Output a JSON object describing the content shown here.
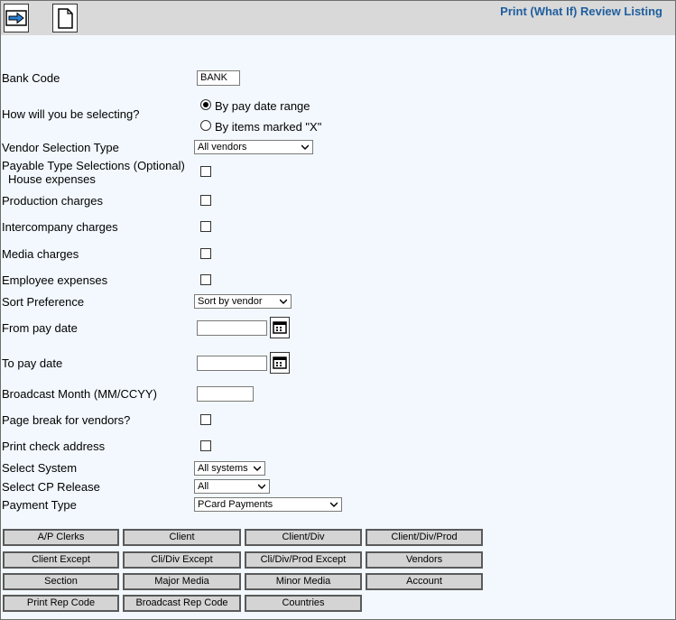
{
  "header": {
    "title": "Print (What If) Review Listing",
    "icons": [
      "arrow-right-icon",
      "document-icon"
    ]
  },
  "form": {
    "bank_code_label": "Bank Code",
    "bank_code_value": "BANK",
    "selecting_label": "How will you be selecting?",
    "radio_pay_date": "By pay date range",
    "radio_items_x": "By items marked \"X\"",
    "vendor_selection_label": "Vendor Selection Type",
    "vendor_selection_value": "All vendors",
    "payable_type_label": "Payable Type Selections (Optional)",
    "house_expenses_label": "House expenses",
    "production_charges_label": "Production charges",
    "intercompany_charges_label": "Intercompany charges",
    "media_charges_label": "Media charges",
    "employee_expenses_label": "Employee expenses",
    "sort_preference_label": "Sort Preference",
    "sort_preference_value": "Sort by vendor",
    "from_pay_date_label": "From pay date",
    "to_pay_date_label": "To pay date",
    "broadcast_month_label": "Broadcast Month (MM/CCYY)",
    "page_break_label": "Page break for vendors?",
    "print_check_address_label": "Print check address",
    "select_system_label": "Select System",
    "select_system_value": "All systems",
    "select_cp_release_label": "Select CP Release",
    "select_cp_release_value": "All",
    "payment_type_label": "Payment Type",
    "payment_type_value": "PCard Payments"
  },
  "buttons": {
    "ap_clerks": "A/P Clerks",
    "client": "Client",
    "client_div": "Client/Div",
    "client_div_prod": "Client/Div/Prod",
    "client_except": "Client Except",
    "cli_div_except": "Cli/Div Except",
    "cli_div_prod_except": "Cli/Div/Prod Except",
    "vendors": "Vendors",
    "section": "Section",
    "major_media": "Major Media",
    "minor_media": "Minor Media",
    "account": "Account",
    "print_rep_code": "Print Rep Code",
    "broadcast_rep_code": "Broadcast Rep Code",
    "countries": "Countries"
  },
  "colors": {
    "title": "#1f5e9e",
    "topbar": "#d9d9d9",
    "background": "#f2f8fd",
    "arrow": "#2a7fd4"
  }
}
